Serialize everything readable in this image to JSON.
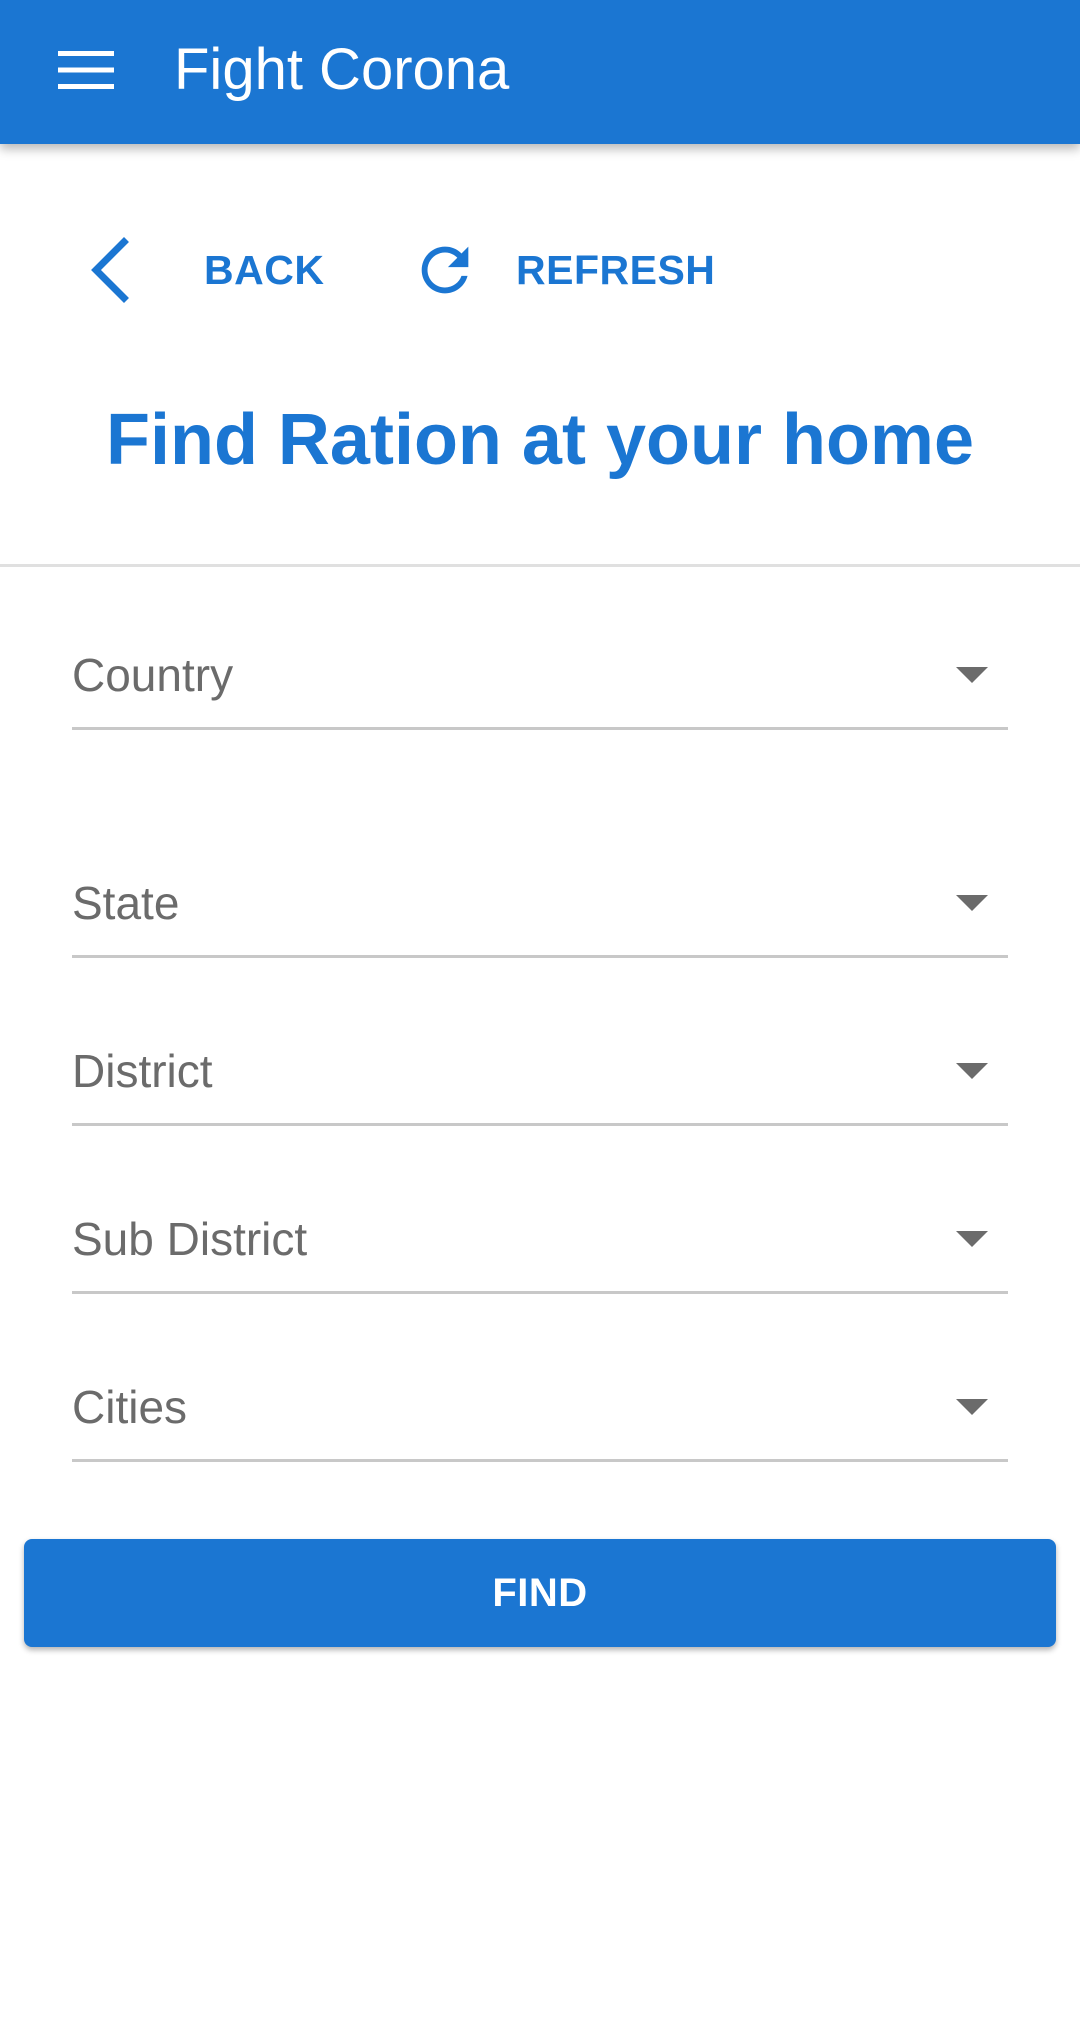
{
  "app_bar": {
    "title": "Fight Corona",
    "menu_icon": "hamburger-menu-icon",
    "background_color": "#1b76d2"
  },
  "actions": {
    "back_label": "BACK",
    "back_icon": "chevron-left-icon",
    "refresh_label": "REFRESH",
    "refresh_icon": "refresh-icon"
  },
  "page": {
    "heading": "Find Ration at your home"
  },
  "form": {
    "fields": [
      {
        "label": "Country"
      },
      {
        "label": "State"
      },
      {
        "label": "District"
      },
      {
        "label": "Sub District"
      },
      {
        "label": "Cities"
      }
    ],
    "submit_label": "FIND"
  },
  "colors": {
    "accent": "#1b76d2",
    "field_text": "#6b6b6b",
    "field_underline": "#c8c8c8"
  }
}
